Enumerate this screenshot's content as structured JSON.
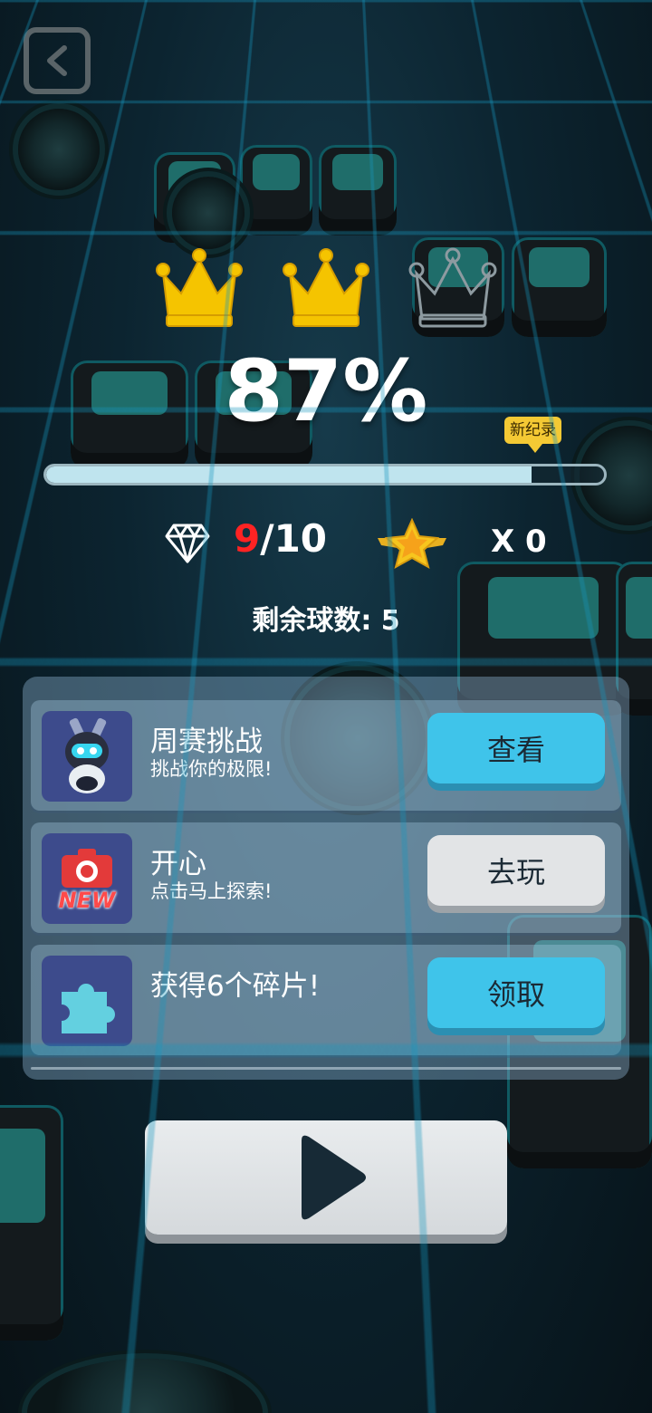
{
  "hud": {
    "crowns_earned": 2,
    "crowns_total": 3,
    "percent": "87%",
    "progress": 0.87,
    "new_record_badge": "新纪录",
    "gems_collected": "9",
    "gems_total": "/10",
    "stars": "X 0",
    "balls_left": "剩余球数: 5"
  },
  "panel": {
    "rows": [
      {
        "title": "周赛挑战",
        "subtitle": "挑战你的极限!",
        "button": "查看",
        "button_style": "blue",
        "icon": "robot-character-icon"
      },
      {
        "title": "开心",
        "subtitle": "点击马上探索!",
        "button": "去玩",
        "button_style": "gray",
        "icon": "new-camera-icon",
        "icon_text": "NEW"
      },
      {
        "title": "获得6个碎片!",
        "subtitle": "",
        "button": "领取",
        "button_style": "blue",
        "icon": "puzzle-piece-icon"
      }
    ]
  },
  "colors": {
    "gold": "#f5c400",
    "accent_blue": "#3fc4ea",
    "gem_red": "#ff2323"
  }
}
